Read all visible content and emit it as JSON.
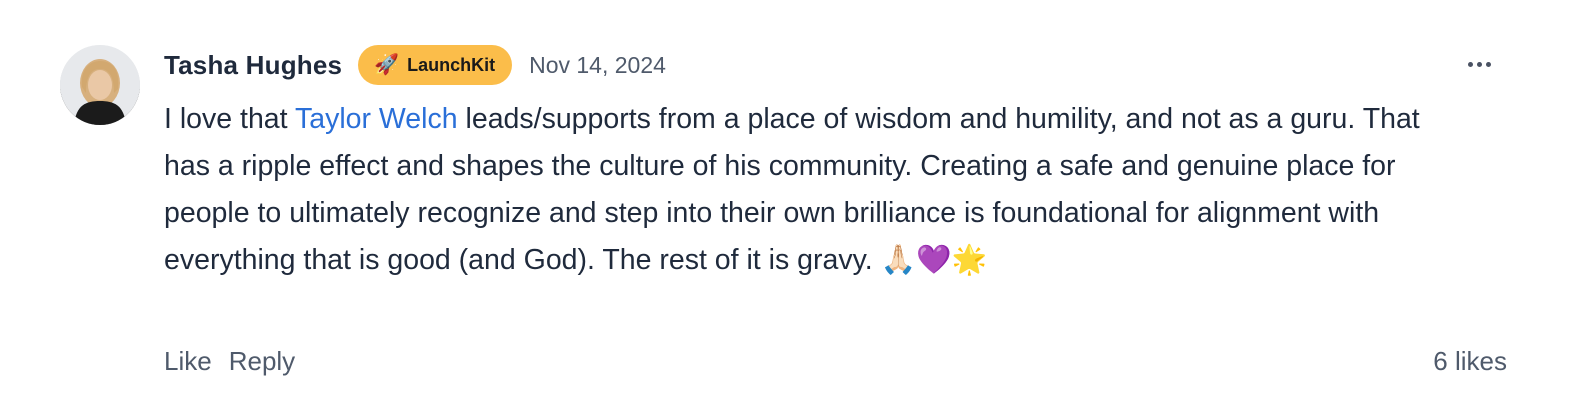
{
  "comment": {
    "author": "Tasha Hughes",
    "badge": {
      "icon": "rocket-icon",
      "icon_glyph": "🚀",
      "label": "LaunchKit",
      "color": "#fbbd4a"
    },
    "date": "Nov 14, 2024",
    "more_menu_icon": "more-horizontal-icon",
    "body": {
      "prefix": "I love that ",
      "mention": "Taylor Welch",
      "suffix": " leads/supports from a place of wisdom and humility, and not as a guru. That has a ripple effect and shapes the culture of his community. Creating a safe and genuine place for people to ultimately recognize and step into their own brilliance is foundational for alignment with everything that is good (and God). The rest of it is gravy. 🙏🏻💜🌟"
    },
    "actions": {
      "like_label": "Like",
      "reply_label": "Reply"
    },
    "likes_count": "6 likes"
  },
  "colors": {
    "text": "#1f2a3c",
    "muted": "#4f5a6b",
    "mention": "#2a6fd8",
    "badge_bg": "#fbbd4a"
  }
}
